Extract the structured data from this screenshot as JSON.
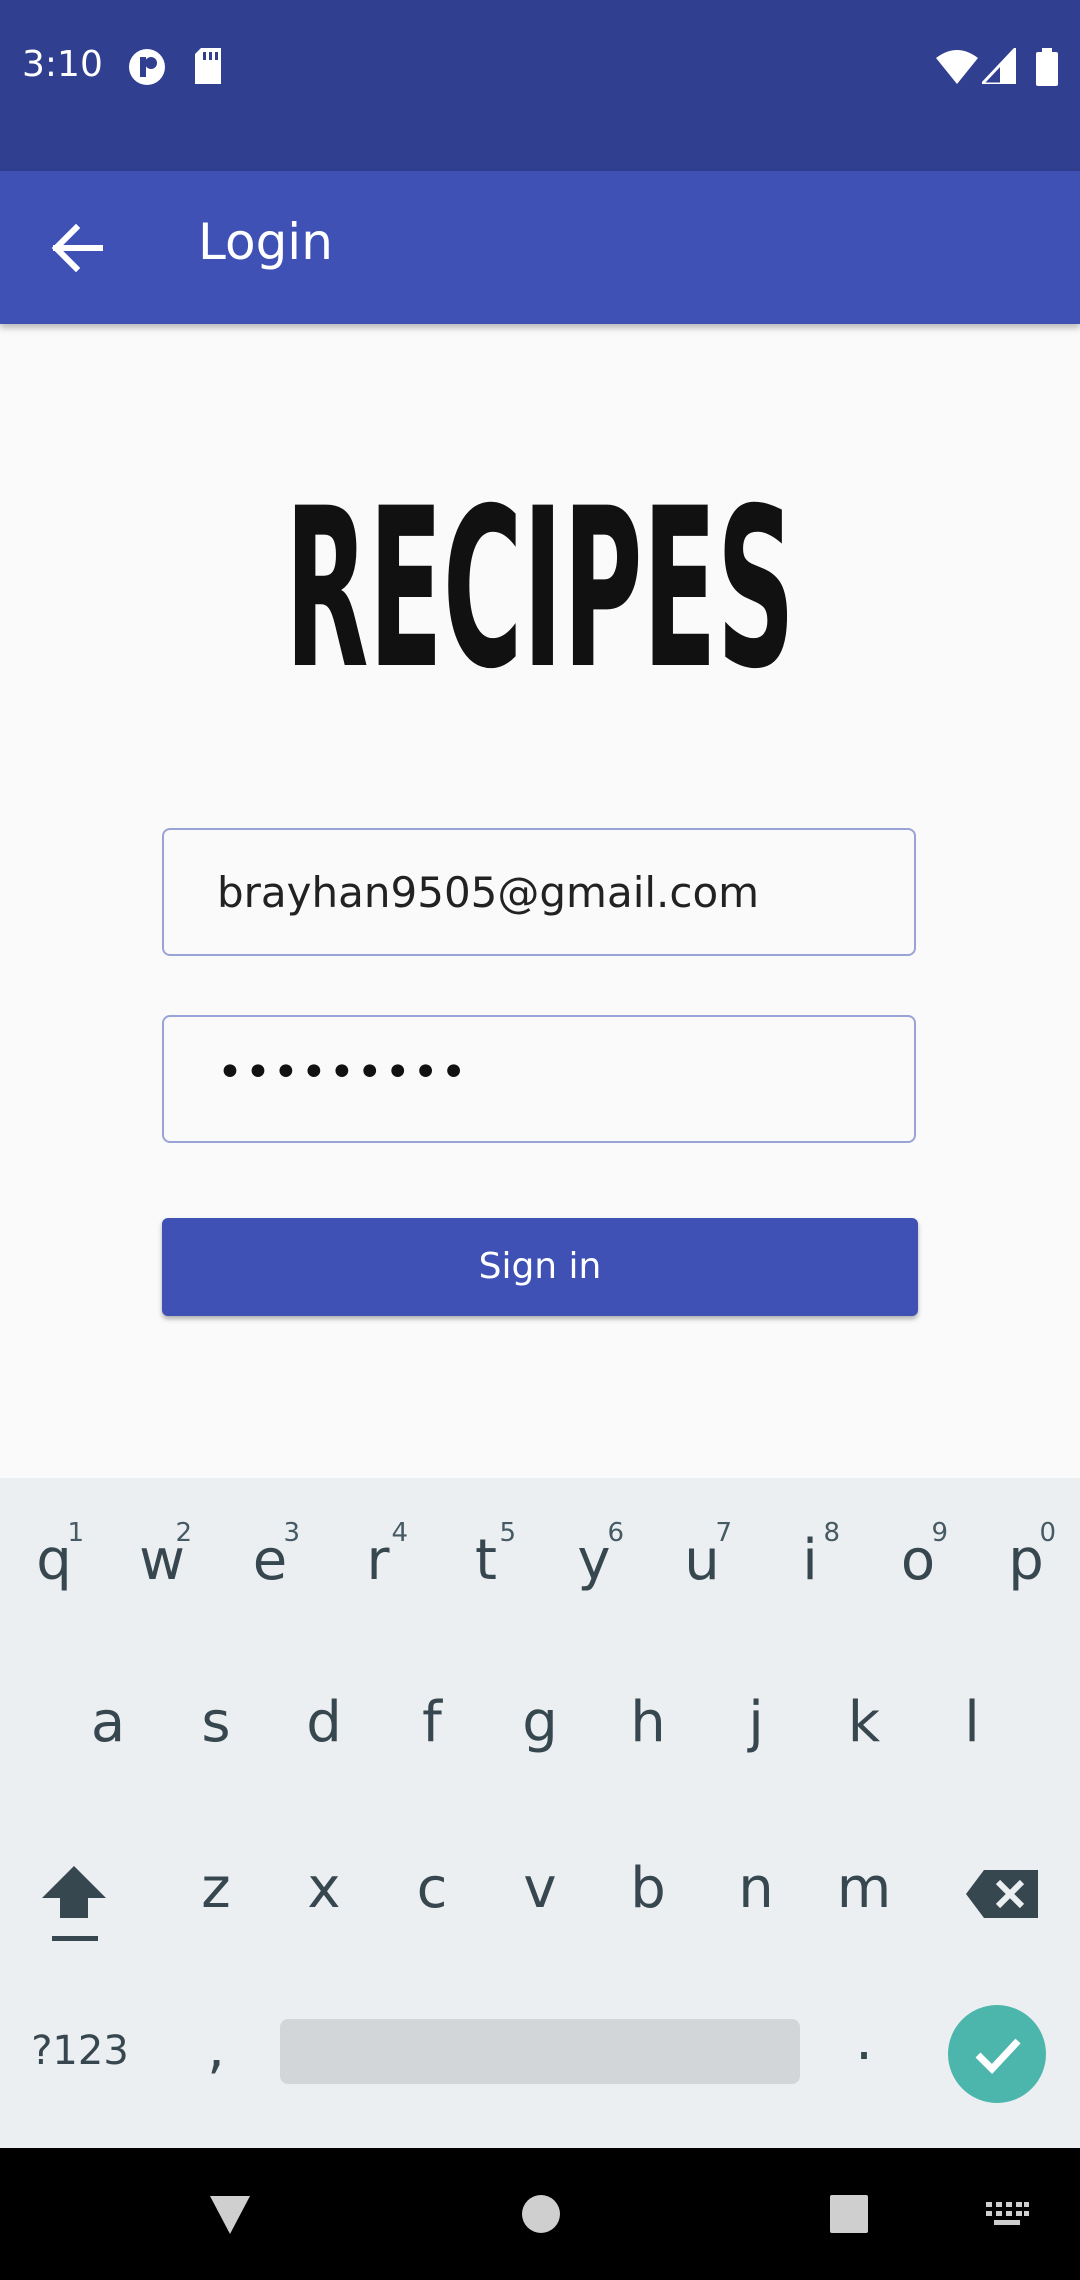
{
  "status_bar": {
    "time": "3:10",
    "icons": [
      "notification-app-icon",
      "sd-card-icon",
      "wifi-icon",
      "signal-icon",
      "battery-icon"
    ]
  },
  "app_bar": {
    "title": "Login",
    "back_icon": "arrow-back-icon"
  },
  "logo_text": "RECIPES",
  "form": {
    "email_value": "brayhan9505@gmail.com",
    "password_dots": "•••••••••",
    "sign_in_label": "Sign in"
  },
  "keyboard": {
    "row1": [
      {
        "char": "q",
        "num": "1"
      },
      {
        "char": "w",
        "num": "2"
      },
      {
        "char": "e",
        "num": "3"
      },
      {
        "char": "r",
        "num": "4"
      },
      {
        "char": "t",
        "num": "5"
      },
      {
        "char": "y",
        "num": "6"
      },
      {
        "char": "u",
        "num": "7"
      },
      {
        "char": "i",
        "num": "8"
      },
      {
        "char": "o",
        "num": "9"
      },
      {
        "char": "p",
        "num": "0"
      }
    ],
    "row2": [
      "a",
      "s",
      "d",
      "f",
      "g",
      "h",
      "j",
      "k",
      "l"
    ],
    "row3": [
      "z",
      "x",
      "c",
      "v",
      "b",
      "n",
      "m"
    ],
    "symbols_label": "?123",
    "comma": ",",
    "period": "."
  },
  "colors": {
    "status_bar": "#303f8f",
    "primary": "#3f51b5",
    "accent_enter": "#4db6ac",
    "keyboard_bg": "#eceff1"
  }
}
